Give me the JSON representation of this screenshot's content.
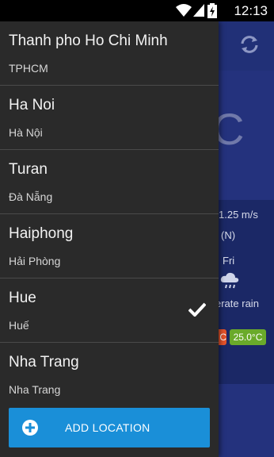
{
  "status_bar": {
    "time": "12:13"
  },
  "background": {
    "temp_fragment": "C",
    "wind": "1.25 m/s",
    "direction": "(N)",
    "day": "Fri",
    "condition": "erate rain",
    "temp_badge_a": "C",
    "temp_badge_b": "25.0°C"
  },
  "drawer": {
    "locations": [
      {
        "name": "Thanh pho Ho Chi Minh",
        "subtitle": "TPHCM"
      },
      {
        "name": "Ha Noi",
        "subtitle": "Hà Nội"
      },
      {
        "name": "Turan",
        "subtitle": "Đà Nẵng"
      },
      {
        "name": "Haiphong",
        "subtitle": "Hải Phòng"
      },
      {
        "name": "Hue",
        "subtitle": "Huế",
        "selected": true
      },
      {
        "name": "Nha Trang",
        "subtitle": "Nha Trang"
      }
    ],
    "add_button_label": "ADD LOCATION"
  },
  "colors": {
    "drawer_bg": "#2a2a2a",
    "accent": "#1a8fd8",
    "app_bg": "#24327d"
  }
}
